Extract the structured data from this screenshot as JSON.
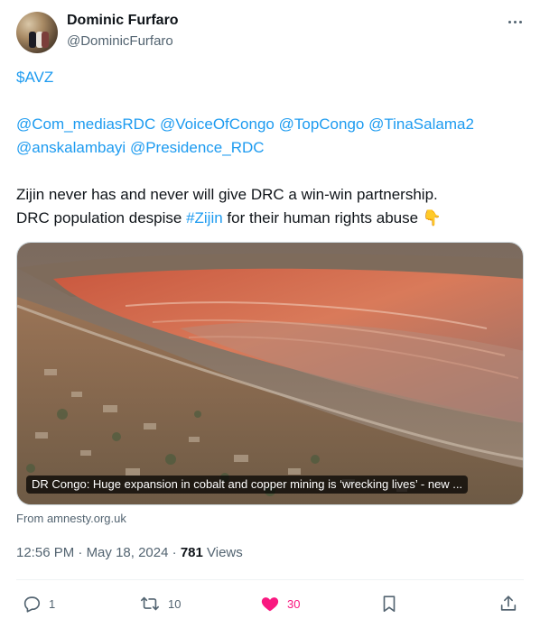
{
  "author": {
    "name": "Dominic Furfaro",
    "handle": "@DominicFurfaro"
  },
  "tweet": {
    "cashtag": "$AVZ",
    "mentions_line1": [
      "@Com_mediasRDC",
      "@VoiceOfCongo",
      "@TopCongo",
      "@TinaSalama2"
    ],
    "mentions_line2": [
      "@anskalambayi",
      "@Presidence_RDC"
    ],
    "body_line1": "Zijin never has and never will give DRC a win-win partnership.",
    "body_line2_before": "DRC population despise ",
    "body_line2_hashtag": "#Zijin",
    "body_line2_after": " for their human rights abuse ",
    "emoji": "👇"
  },
  "card": {
    "caption": "DR Congo: Huge expansion in cobalt and copper mining is ‘wrecking lives’ - new ...",
    "source": "From amnesty.org.uk"
  },
  "meta": {
    "time": "12:56 PM",
    "date": "May 18, 2024",
    "views_count": "781",
    "views_label": "Views"
  },
  "actions": {
    "replies": "1",
    "reposts": "10",
    "likes": "30"
  },
  "colors": {
    "link": "#1d9bf0",
    "like": "#f91880",
    "secondary": "#536471"
  },
  "icons": [
    "more-icon",
    "reply-icon",
    "repost-icon",
    "like-icon",
    "bookmark-icon",
    "share-icon"
  ]
}
